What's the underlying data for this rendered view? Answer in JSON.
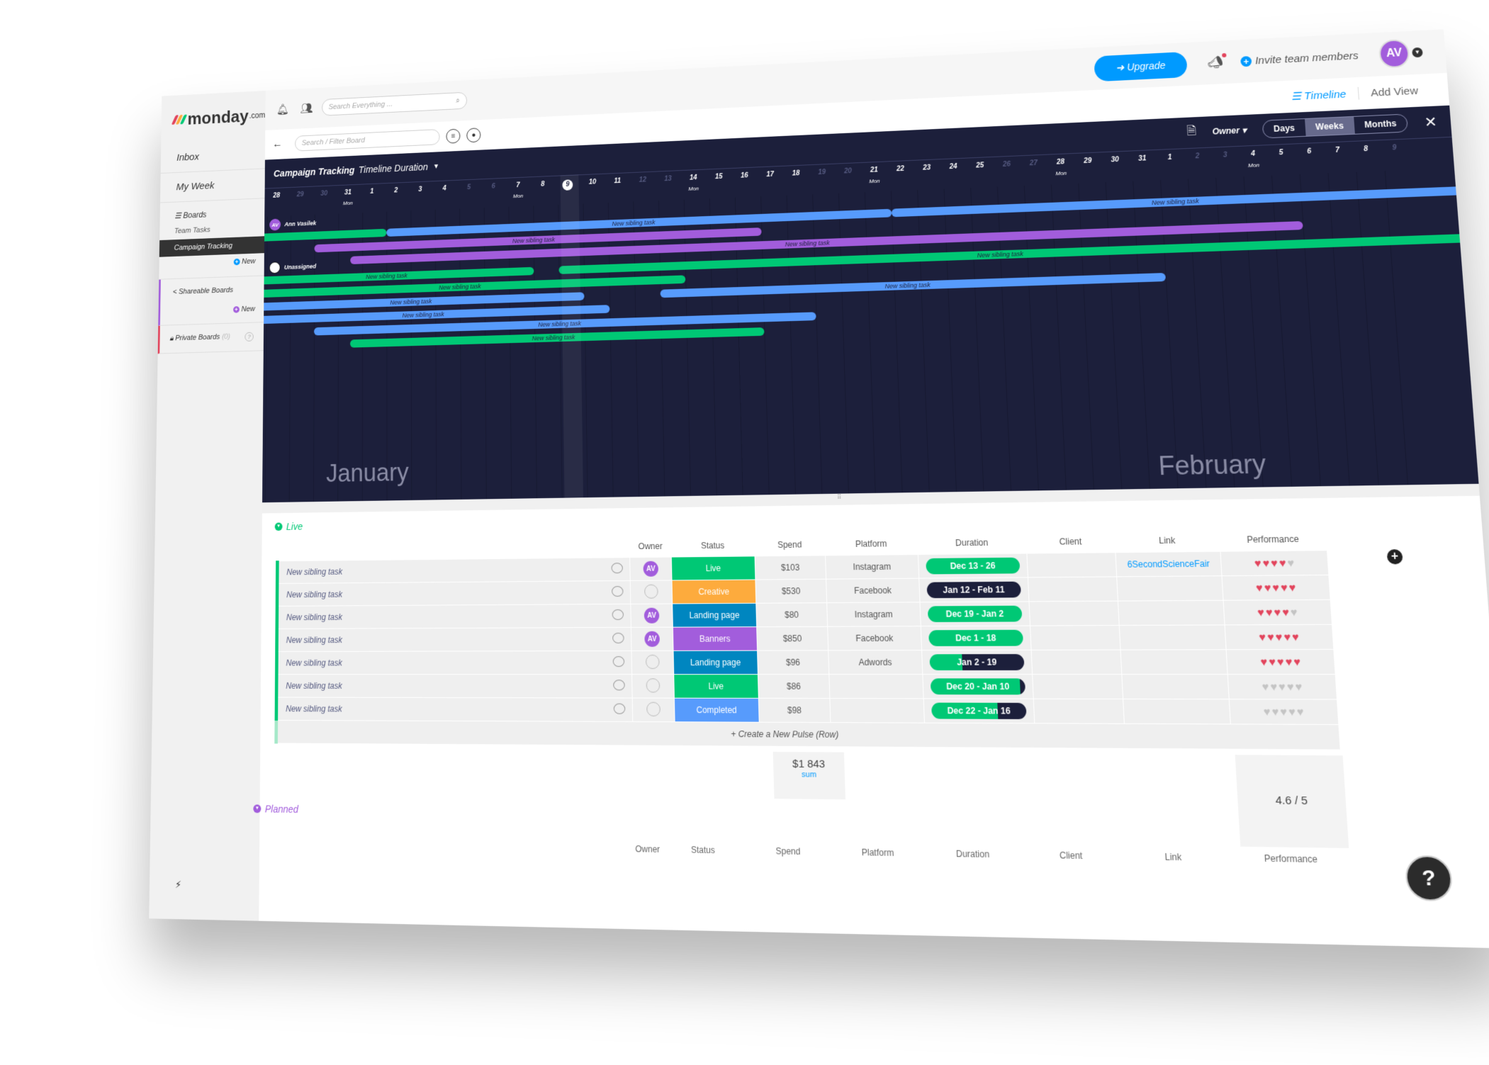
{
  "sidebar": {
    "logo": "monday",
    "logo_suffix": ".com",
    "inbox": "Inbox",
    "my_week": "My Week",
    "boards_header": "Boards",
    "boards": [
      {
        "label": "Team Tasks",
        "active": false
      },
      {
        "label": "Campaign Tracking",
        "active": true
      }
    ],
    "new_label": "New",
    "shareable_header": "Shareable Boards",
    "private_header": "Private Boards",
    "private_count": "(0)"
  },
  "topbar": {
    "search_placeholder": "Search Everything ...",
    "upgrade_label": "Upgrade",
    "invite_label": "Invite team members",
    "avatar_initials": "AV"
  },
  "subbar": {
    "filter_placeholder": "Search / Filter Board",
    "views": {
      "active": "Timeline",
      "add": "Add View"
    }
  },
  "timeline": {
    "board_name": "Campaign Tracking",
    "column_name": "Timeline Duration",
    "group_by": "Owner",
    "scale_options": [
      "Days",
      "Weeks",
      "Months"
    ],
    "scale_selected": "Weeks",
    "days": [
      {
        "d": "28",
        "dim": false
      },
      {
        "d": "29",
        "dim": true
      },
      {
        "d": "30",
        "dim": true
      },
      {
        "d": "31",
        "dim": false,
        "mon": "Mon"
      },
      {
        "d": "1",
        "dim": false
      },
      {
        "d": "2",
        "dim": false
      },
      {
        "d": "3",
        "dim": false
      },
      {
        "d": "4",
        "dim": false
      },
      {
        "d": "5",
        "dim": true
      },
      {
        "d": "6",
        "dim": true
      },
      {
        "d": "7",
        "dim": false,
        "mon": "Mon"
      },
      {
        "d": "8",
        "dim": false
      },
      {
        "d": "9",
        "dim": false,
        "today": true
      },
      {
        "d": "10",
        "dim": false
      },
      {
        "d": "11",
        "dim": false
      },
      {
        "d": "12",
        "dim": true
      },
      {
        "d": "13",
        "dim": true
      },
      {
        "d": "14",
        "dim": false,
        "mon": "Mon"
      },
      {
        "d": "15",
        "dim": false
      },
      {
        "d": "16",
        "dim": false
      },
      {
        "d": "17",
        "dim": false
      },
      {
        "d": "18",
        "dim": false
      },
      {
        "d": "19",
        "dim": true
      },
      {
        "d": "20",
        "dim": true
      },
      {
        "d": "21",
        "dim": false,
        "mon": "Mon"
      },
      {
        "d": "22",
        "dim": false
      },
      {
        "d": "23",
        "dim": false
      },
      {
        "d": "24",
        "dim": false
      },
      {
        "d": "25",
        "dim": false
      },
      {
        "d": "26",
        "dim": true
      },
      {
        "d": "27",
        "dim": true
      },
      {
        "d": "28",
        "dim": false,
        "mon": "Mon"
      },
      {
        "d": "29",
        "dim": false
      },
      {
        "d": "30",
        "dim": false
      },
      {
        "d": "31",
        "dim": false
      },
      {
        "d": "1",
        "dim": false
      },
      {
        "d": "2",
        "dim": true
      },
      {
        "d": "3",
        "dim": true
      },
      {
        "d": "4",
        "dim": false,
        "mon": "Mon"
      },
      {
        "d": "5",
        "dim": false
      },
      {
        "d": "6",
        "dim": false
      },
      {
        "d": "7",
        "dim": false
      },
      {
        "d": "8",
        "dim": false
      },
      {
        "d": "9",
        "dim": true
      }
    ],
    "groups": [
      {
        "name": "Ann Vasilek",
        "initials": "AV",
        "type": "user"
      },
      {
        "name": "Unassigned",
        "type": "unassigned"
      }
    ],
    "bars": [
      {
        "group": 0,
        "row": 0,
        "start": -1,
        "end": 5,
        "color": "green",
        "label": ""
      },
      {
        "group": 0,
        "row": 0,
        "start": 5,
        "end": 25,
        "color": "blue",
        "label": "New sibling task"
      },
      {
        "group": 0,
        "row": 0,
        "start": 25,
        "end": 46,
        "color": "blue",
        "label": "New sibling task"
      },
      {
        "group": 0,
        "row": 1,
        "start": 2,
        "end": 20,
        "color": "purple",
        "label": "New sibling task"
      },
      {
        "group": 0,
        "row": 2,
        "start": 3.5,
        "end": 40,
        "color": "purple",
        "label": "New sibling task"
      },
      {
        "group": 1,
        "row": 0,
        "start": -1,
        "end": 11,
        "color": "green",
        "label": "New sibling task"
      },
      {
        "group": 1,
        "row": 0,
        "start": 12,
        "end": 46,
        "color": "green",
        "label": "New sibling task"
      },
      {
        "group": 1,
        "row": 1,
        "start": -1,
        "end": 17,
        "color": "green",
        "label": "New sibling task"
      },
      {
        "group": 1,
        "row": 2,
        "start": -1,
        "end": 13,
        "color": "blue",
        "label": "New sibling task"
      },
      {
        "group": 1,
        "row": 2,
        "start": 16,
        "end": 35,
        "color": "blue",
        "label": "New sibling task"
      },
      {
        "group": 1,
        "row": 3,
        "start": -1,
        "end": 14,
        "color": "blue",
        "label": "New sibling task"
      },
      {
        "group": 1,
        "row": 4,
        "start": 2,
        "end": 22,
        "color": "blue",
        "label": "New sibling task"
      },
      {
        "group": 1,
        "row": 5,
        "start": 3.5,
        "end": 20,
        "color": "green",
        "label": "New sibling task"
      }
    ],
    "months": [
      "January",
      "February"
    ]
  },
  "board": {
    "groups": [
      {
        "name": "Live",
        "color": "#00c875"
      },
      {
        "name": "Planned",
        "color": "#a25ddc"
      }
    ],
    "columns": [
      "Owner",
      "Status",
      "Spend",
      "Platform",
      "Duration",
      "Client",
      "Link",
      "Performance"
    ],
    "rows": [
      {
        "name": "New sibling task",
        "owner": "AV",
        "status": "Live",
        "status_color": "#00c875",
        "spend": "$103",
        "platform": "Instagram",
        "duration": "Dec 13 - 26",
        "dur_fill": 1.0,
        "link": "6SecondScienceFair",
        "rating": 4
      },
      {
        "name": "New sibling task",
        "owner": "",
        "status": "Creative",
        "status_color": "#fdab3d",
        "spend": "$530",
        "platform": "Facebook",
        "duration": "Jan 12 - Feb 11",
        "dur_fill": 0.0,
        "link": "",
        "rating": 5
      },
      {
        "name": "New sibling task",
        "owner": "AV",
        "status": "Landing page",
        "status_color": "#0086c0",
        "spend": "$80",
        "platform": "Instagram",
        "duration": "Dec 19 - Jan 2",
        "dur_fill": 1.0,
        "link": "",
        "rating": 4
      },
      {
        "name": "New sibling task",
        "owner": "AV",
        "status": "Banners",
        "status_color": "#a25ddc",
        "spend": "$850",
        "platform": "Facebook",
        "duration": "Dec 1 - 18",
        "dur_fill": 1.0,
        "link": "",
        "rating": 5
      },
      {
        "name": "New sibling task",
        "owner": "",
        "status": "Landing page",
        "status_color": "#0086c0",
        "spend": "$96",
        "platform": "Adwords",
        "duration": "Jan 2 - 19",
        "dur_fill": 0.35,
        "link": "",
        "rating": 5
      },
      {
        "name": "New sibling task",
        "owner": "",
        "status": "Live",
        "status_color": "#00c875",
        "spend": "$86",
        "platform": "",
        "duration": "Dec 20 - Jan 10",
        "dur_fill": 0.95,
        "link": "",
        "rating": 0
      },
      {
        "name": "New sibling task",
        "owner": "",
        "status": "Completed",
        "status_color": "#579bfc",
        "spend": "$98",
        "platform": "",
        "duration": "Dec 22 - Jan 16",
        "dur_fill": 0.7,
        "link": "",
        "rating": 0
      }
    ],
    "create_row": "+ Create a New Pulse (Row)",
    "spend_sum": "$1 843",
    "spend_sum_label": "sum",
    "performance_avg": "4.6 / 5"
  },
  "colors": {
    "green": "#00c875",
    "blue": "#579bfc",
    "purple": "#a25ddc",
    "dark": "#1c1f3b",
    "heart_on": "#e2445c",
    "heart_off": "#c4c4c4",
    "accent": "#009aff"
  },
  "icons": {
    "bell": "bell-icon",
    "people": "people-icon",
    "search": "search-icon",
    "megaphone": "megaphone-icon",
    "filter": "filter-icon",
    "person": "person-icon",
    "export": "export-icon",
    "close": "close-icon",
    "help": "help-icon",
    "bolt": "bolt-icon"
  }
}
